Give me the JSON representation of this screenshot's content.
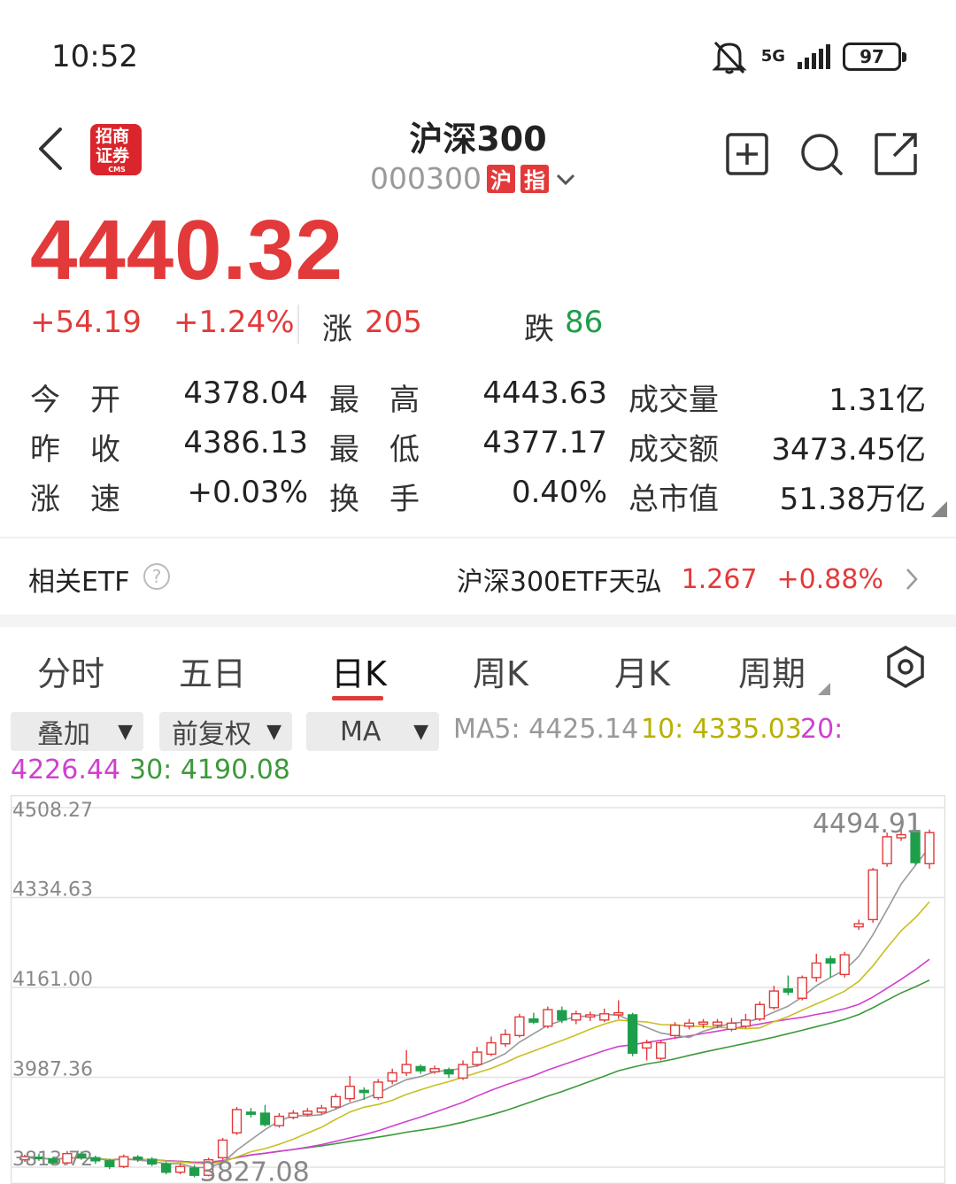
{
  "status": {
    "time": "10:52",
    "network": "5G",
    "battery": "97"
  },
  "header": {
    "title": "沪深300",
    "code": "000300",
    "tag1": "沪",
    "tag2": "指"
  },
  "quote": {
    "price": "4440.32",
    "change": "+54.19",
    "change_pct": "+1.24%",
    "up_label": "涨",
    "up_count": "205",
    "down_label": "跌",
    "down_count": "86"
  },
  "stats": {
    "open_label": "今　开",
    "open": "4378.04",
    "high_label": "最　高",
    "high": "4443.63",
    "volume_label": "成交量",
    "volume": "1.31亿",
    "prev_label": "昨　收",
    "prev": "4386.13",
    "low_label": "最　低",
    "low": "4377.17",
    "amount_label": "成交额",
    "amount": "3473.45亿",
    "speed_label": "涨　速",
    "speed": "+0.03%",
    "turnover_label": "换　手",
    "turnover": "0.40%",
    "mktcap_label": "总市值",
    "mktcap": "51.38万亿"
  },
  "etf": {
    "label": "相关ETF",
    "help": "?",
    "name": "沪深300ETF天弘",
    "price": "1.267",
    "pct": "+0.88%"
  },
  "tabs": [
    "分时",
    "五日",
    "日K",
    "周K",
    "月K",
    "周期"
  ],
  "active_tab": "日K",
  "dropdowns": [
    "叠加",
    "前复权",
    "MA"
  ],
  "ma": {
    "ma5": "MA5: 4425.14",
    "ma10": "10: 4335.03",
    "ma20_label": "20:",
    "ma20": "4226.44",
    "ma30": "30: 4190.08"
  },
  "colors": {
    "up": "#e23a3a",
    "down": "#1e9e4a",
    "ma5": "#999999",
    "ma10": "#c8c020",
    "ma20": "#d040d0",
    "ma30": "#3a9a3a"
  },
  "chart_data": {
    "type": "candlestick",
    "y_ticks": [
      "4508.27",
      "4334.63",
      "4161.00",
      "3987.36",
      "3813.72"
    ],
    "ylim": [
      3813.72,
      4508.27
    ],
    "annotations": {
      "max_label": "4494.91",
      "min_label": "3827.08"
    },
    "candles": [
      [
        3828,
        3834,
        3838,
        3824
      ],
      [
        3833,
        3830,
        3840,
        3826
      ],
      [
        3830,
        3822,
        3834,
        3818
      ],
      [
        3822,
        3840,
        3845,
        3818
      ],
      [
        3839,
        3832,
        3844,
        3828
      ],
      [
        3832,
        3826,
        3836,
        3820
      ],
      [
        3826,
        3815,
        3830,
        3810
      ],
      [
        3815,
        3834,
        3838,
        3812
      ],
      [
        3833,
        3829,
        3837,
        3824
      ],
      [
        3829,
        3820,
        3833,
        3816
      ],
      [
        3820,
        3804,
        3824,
        3800
      ],
      [
        3804,
        3815,
        3820,
        3800
      ],
      [
        3812,
        3798,
        3818,
        3794
      ],
      [
        3798,
        3828,
        3832,
        3796
      ],
      [
        3832,
        3866,
        3870,
        3828
      ],
      [
        3880,
        3925,
        3930,
        3876
      ],
      [
        3920,
        3916,
        3928,
        3910
      ],
      [
        3918,
        3896,
        3934,
        3892
      ],
      [
        3894,
        3912,
        3918,
        3890
      ],
      [
        3910,
        3918,
        3924,
        3906
      ],
      [
        3916,
        3922,
        3928,
        3912
      ],
      [
        3920,
        3928,
        3934,
        3916
      ],
      [
        3930,
        3950,
        3956,
        3926
      ],
      [
        3946,
        3970,
        3990,
        3940
      ],
      [
        3962,
        3958,
        3968,
        3944
      ],
      [
        3948,
        3978,
        3984,
        3944
      ],
      [
        3980,
        3996,
        4004,
        3974
      ],
      [
        3996,
        4012,
        4040,
        3990
      ],
      [
        4008,
        4000,
        4012,
        3994
      ],
      [
        3998,
        4004,
        4010,
        3994
      ],
      [
        4002,
        3994,
        4006,
        3986
      ],
      [
        3986,
        4012,
        4020,
        3982
      ],
      [
        4012,
        4036,
        4046,
        4008
      ],
      [
        4032,
        4054,
        4066,
        4028
      ],
      [
        4052,
        4070,
        4080,
        4046
      ],
      [
        4068,
        4104,
        4110,
        4064
      ],
      [
        4100,
        4094,
        4112,
        4090
      ],
      [
        4086,
        4118,
        4124,
        4082
      ],
      [
        4116,
        4098,
        4124,
        4092
      ],
      [
        4098,
        4110,
        4116,
        4090
      ],
      [
        4104,
        4108,
        4114,
        4096
      ],
      [
        4098,
        4110,
        4120,
        4094
      ],
      [
        4108,
        4112,
        4136,
        4100
      ],
      [
        4108,
        4034,
        4112,
        4028
      ],
      [
        4044,
        4054,
        4060,
        4020
      ],
      [
        4024,
        4054,
        4058,
        4020
      ],
      [
        4068,
        4088,
        4094,
        4062
      ],
      [
        4086,
        4092,
        4100,
        4080
      ],
      [
        4090,
        4094,
        4100,
        4082
      ],
      [
        4088,
        4094,
        4100,
        4082
      ],
      [
        4080,
        4092,
        4102,
        4076
      ],
      [
        4086,
        4098,
        4110,
        4082
      ],
      [
        4100,
        4128,
        4134,
        4096
      ],
      [
        4122,
        4154,
        4164,
        4118
      ],
      [
        4158,
        4152,
        4184,
        4146
      ],
      [
        4140,
        4180,
        4184,
        4136
      ],
      [
        4180,
        4208,
        4226,
        4172
      ],
      [
        4216,
        4208,
        4222,
        4180
      ],
      [
        4186,
        4224,
        4230,
        4180
      ],
      [
        4278,
        4284,
        4292,
        4272
      ],
      [
        4292,
        4388,
        4392,
        4286
      ],
      [
        4400,
        4452,
        4460,
        4394
      ],
      [
        4450,
        4456,
        4468,
        4444
      ],
      [
        4464,
        4402,
        4494.91,
        4398
      ],
      [
        4400,
        4460,
        4466,
        4390
      ]
    ]
  }
}
